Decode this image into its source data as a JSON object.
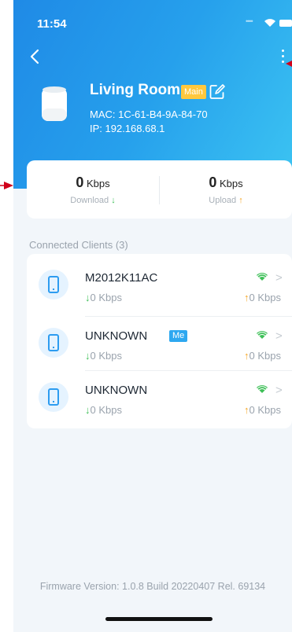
{
  "status_bar": {
    "time": "11:54"
  },
  "device": {
    "name": "Living Room",
    "badge": "Main",
    "mac": "MAC: 1C-61-B4-9A-84-70",
    "ip": "IP: 192.168.68.1"
  },
  "speeds": {
    "download": {
      "value": "0",
      "unit": "Kbps",
      "label": "Download",
      "arrow": "↓"
    },
    "upload": {
      "value": "0",
      "unit": "Kbps",
      "label": "Upload",
      "arrow": "↑"
    }
  },
  "clients": {
    "title": "Connected Clients (3)",
    "items": [
      {
        "name": "M2012K11AC",
        "badge": "",
        "down": "0 Kbps",
        "up": "0 Kbps"
      },
      {
        "name": "UNKNOWN",
        "badge": "Me",
        "down": "0 Kbps",
        "up": "0 Kbps"
      },
      {
        "name": "UNKNOWN",
        "badge": "",
        "down": "0 Kbps",
        "up": "0 Kbps"
      }
    ]
  },
  "footer": {
    "firmware": "Firmware Version: 1.0.8 Build 20220407 Rel. 69134"
  },
  "colors": {
    "hero_start": "#1f8ae6",
    "hero_end": "#3cc4f2",
    "main_badge": "#ffc83d",
    "me_badge": "#2ea8f0",
    "wifi": "#3dbf57",
    "download_arrow": "#3dbf57",
    "upload_arrow": "#f5a623",
    "pointer": "#d0021b"
  },
  "icons": {
    "back": "chevron-left-icon",
    "more": "more-vertical-icon",
    "edit": "edit-icon",
    "client": "phone-icon",
    "signal": "wifi-icon",
    "open": "chevron-right-icon"
  }
}
